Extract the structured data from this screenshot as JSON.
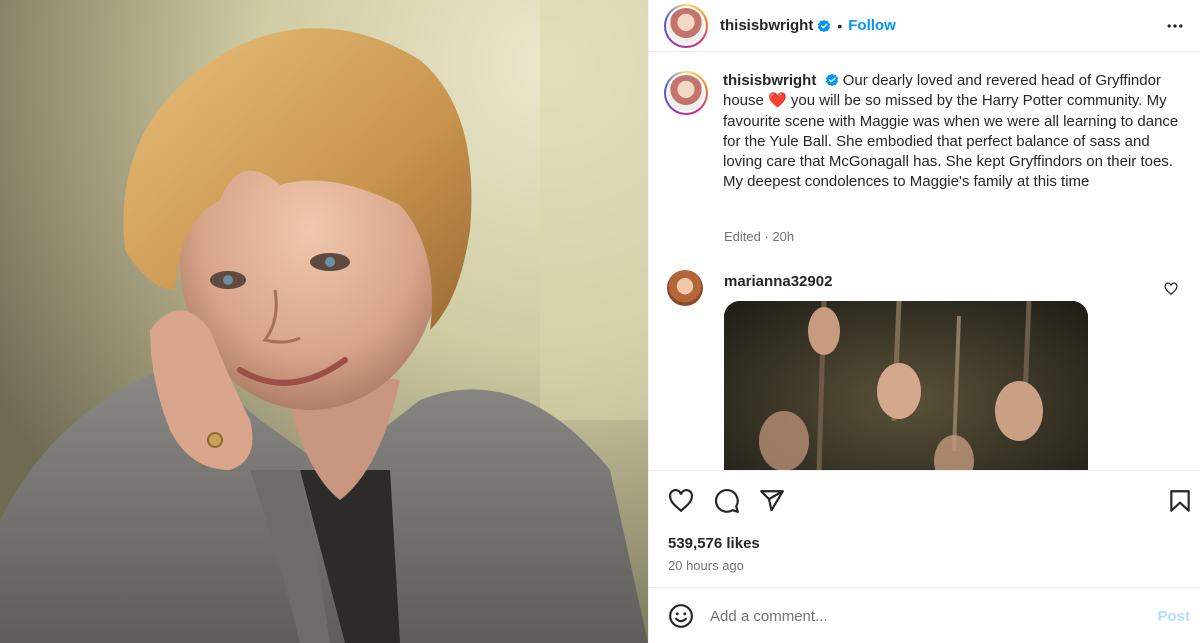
{
  "post": {
    "username": "thisisbwright",
    "follow_label": "Follow",
    "separator": "•",
    "caption": "Our dearly loved and revered head of Gryffindor house ❤️ you will be so missed by the Harry Potter community. My favourite scene with Maggie was when we were all learning to dance for the Yule Ball. She embodied that perfect balance of sass and loving care that McGonagall has. She kept Gryffindors on their toes. My deepest condolences to Maggie's family at this time",
    "caption_before_heart": "Our dearly loved and revered head of Gryffindor house",
    "heart": "❤️",
    "caption_after_heart": "you will be so missed by the Harry Potter community. My favourite scene with Maggie was when we were all learning to dance for the Yule Ball. She embodied that perfect balance of sass and loving care that McGonagall has. She kept Gryffindors on their toes. My deepest condolences to Maggie's family at this time",
    "meta": "Edited · 20h",
    "likes": "539,576 likes",
    "time_ago": "20 hours ago"
  },
  "comments": [
    {
      "username": "marianna32902"
    }
  ],
  "comment_box": {
    "placeholder": "Add a comment...",
    "post_label": "Post"
  },
  "colors": {
    "accent": "#0095f6",
    "verified": "#0095f6",
    "muted": "#737373",
    "post_disabled": "#b2dffc"
  },
  "icons": {
    "header_more": "more-options-icon",
    "verified": "verified-badge-icon",
    "like": "heart-icon",
    "comment": "comment-icon",
    "share": "share-icon",
    "save": "bookmark-icon",
    "emoji": "emoji-icon",
    "comment_like": "small-heart-icon"
  }
}
